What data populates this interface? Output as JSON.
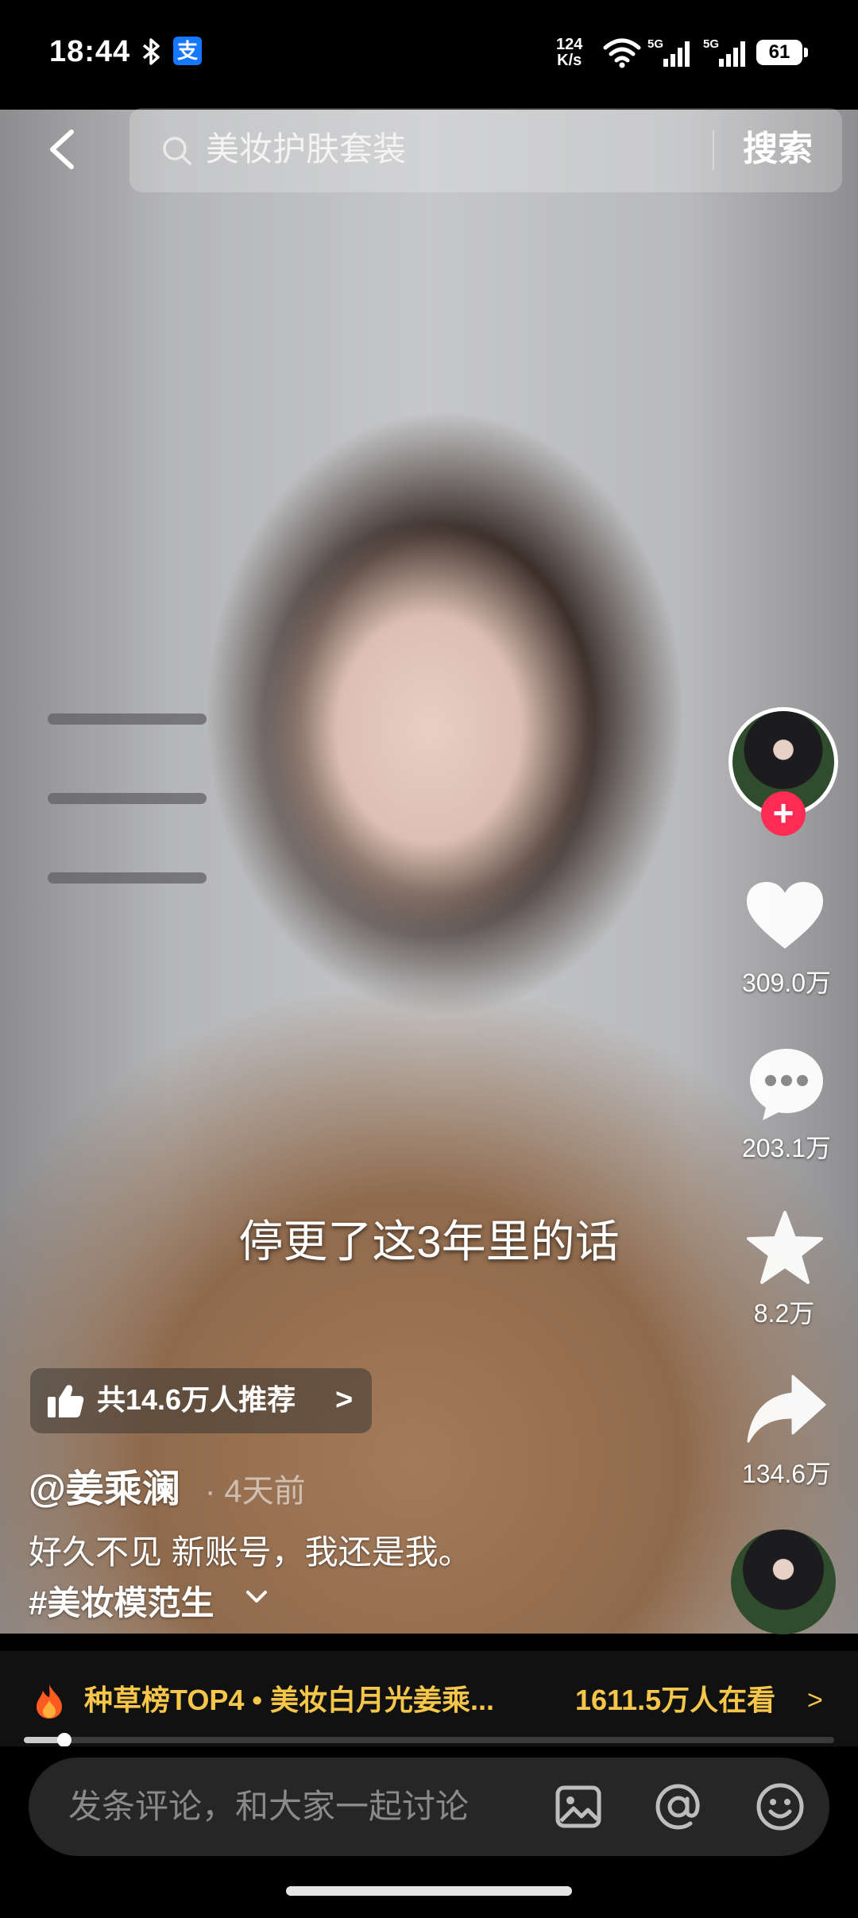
{
  "status_bar": {
    "time": "18:44",
    "net_speed_value": "124",
    "net_speed_unit": "K/s",
    "battery": "61",
    "alipay_glyph": "支"
  },
  "search": {
    "query": "美妆护肤套装",
    "button_label": "搜索"
  },
  "video": {
    "caption": "停更了这3年里的话"
  },
  "actions": {
    "likes": "309.0万",
    "comments": "203.1万",
    "favorites": "8.2万",
    "shares": "134.6万",
    "follow_glyph": "+"
  },
  "recommend": {
    "label": "共14.6万人推荐",
    "chevron": ">"
  },
  "post": {
    "author": "@姜乘澜",
    "time_ago": "· 4天前",
    "description": "好久不见 新账号，我还是我。",
    "hashtag": "#美妆模范生"
  },
  "ranking": {
    "text": "种草榜TOP4 • 美妆白月光姜乘...",
    "viewers": "1611.5万人在看",
    "chevron": ">"
  },
  "playback": {
    "progress_fraction": 0.05
  },
  "comment_bar": {
    "placeholder": "发条评论，和大家一起讨论"
  },
  "colors": {
    "accent_red": "#fe2c55",
    "ranking_gold": "#f5c64a"
  }
}
